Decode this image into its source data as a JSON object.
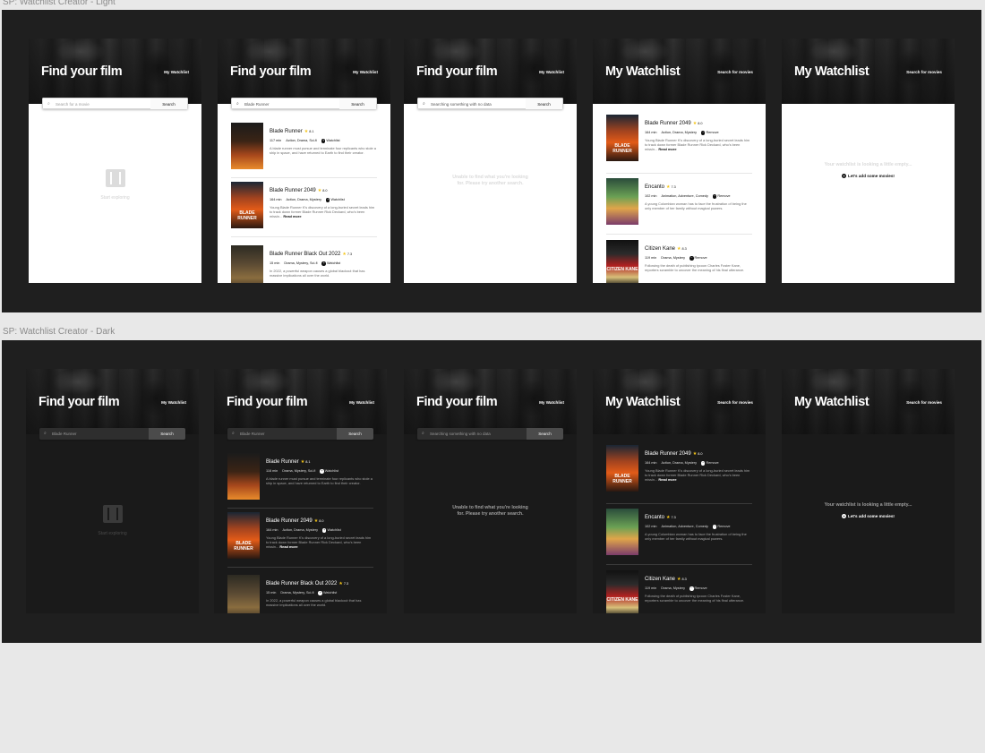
{
  "frames": {
    "light_label": "SP: Watchlist Creator - Light",
    "dark_label": "SP: Watchlist Creator - Dark"
  },
  "hero": {
    "search_title": "Find your film",
    "watchlist_title": "My Watchlist",
    "my_watchlist_link": "My Watchlist",
    "search_movies_link": "Search for movies"
  },
  "search": {
    "placeholder_light": "Search for a movie",
    "query": "Blade Runner",
    "query_nodata": "Searching something with no data",
    "button": "Search"
  },
  "empty": {
    "start_exploring": "Start exploring",
    "not_found_line1": "Unable to find what you're looking",
    "not_found_line2": "for. Please try another search.",
    "watchlist_empty": "Your watchlist is looking a little empty...",
    "add_movies": "Let's add some movies!"
  },
  "actions": {
    "watchlist": "Watchlist",
    "remove": "Remove",
    "read_more": "Read more"
  },
  "movies": {
    "br": {
      "title": "Blade Runner",
      "rating": "8.1",
      "runtime_light": "117 min",
      "runtime_dark": "116 min",
      "genres_light": "Action, Drama, Sci-fi",
      "genres_dark": "Drama, Mystery, Sci-fi",
      "desc": "A blade runner must pursue and terminate four replicants who stole a ship in space, and have returned to Earth to find their creator."
    },
    "br2049": {
      "title": "Blade Runner 2049",
      "rating": "8.0",
      "runtime": "164 min",
      "genres": "Action, Drama, Mystery",
      "desc": "Young Blade Runner K's discovery of a long-buried secret leads him to track down former Blade Runner Rick Deckard, who's been missin...",
      "poster_text": "BLADE RUNNER"
    },
    "blackout": {
      "title": "Blade Runner Black Out 2022",
      "rating": "7.3",
      "runtime": "15 min",
      "genres": "Drama, Mystery, Sci-fi",
      "desc": "In 2022, a powerful weapon causes a global blackout that has massive implications all over the world."
    },
    "encanto": {
      "title": "Encanto",
      "rating": "7.3",
      "runtime": "102 min",
      "genres": "Animation, Adventure, Comedy",
      "desc": "A young Colombian woman has to face the frustration of being the only member of her family without magical powers."
    },
    "kane": {
      "title": "Citizen Kane",
      "rating": "8.3",
      "runtime": "119 min",
      "genres": "Drama, Mystery",
      "desc": "Following the death of publishing tycoon Charles Foster Kane, reporters scramble to uncover the meaning of his final utterance.",
      "poster_text": "CITIZEN KANE"
    }
  },
  "icons": {
    "search": "magnifier-icon",
    "film": "film-icon",
    "plus": "plus-circle-icon",
    "minus": "minus-circle-icon",
    "star": "star-icon"
  },
  "colors": {
    "canvas": "#e8e8e8",
    "frame": "#1f1f1f",
    "star": "#f5c518",
    "dark_bg": "#1a1a1a",
    "light_bg": "#ffffff"
  }
}
